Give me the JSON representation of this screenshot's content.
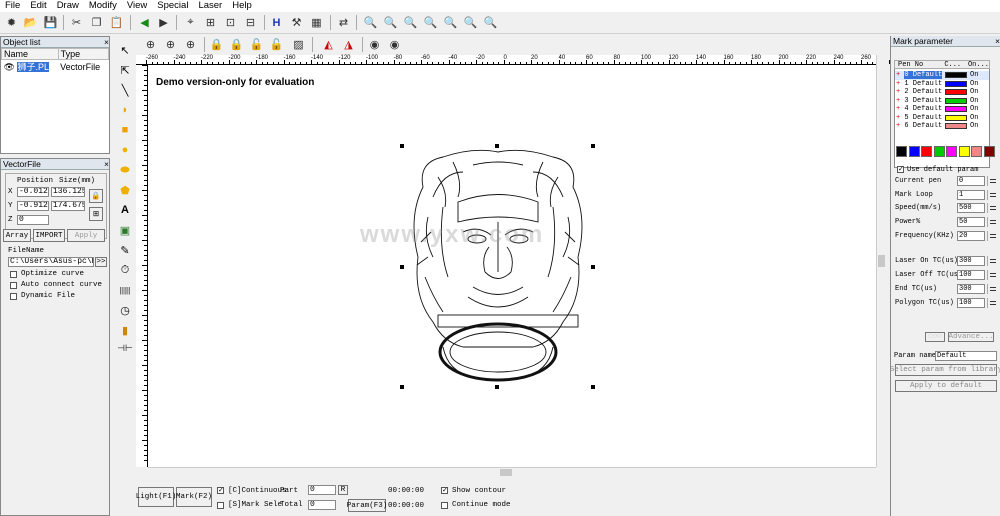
{
  "menu": [
    "File",
    "Edit",
    "Draw",
    "Modify",
    "View",
    "Special",
    "Laser",
    "Help"
  ],
  "object_list": {
    "title": "Object list",
    "columns": [
      "Name",
      "Type"
    ],
    "rows": [
      {
        "name": "狮子.PL",
        "type": "VectorFile"
      }
    ]
  },
  "vector_file": {
    "title": "VectorFile",
    "position_label": "Position",
    "size_label": "Size(mm)",
    "x_label": "X",
    "y_label": "Y",
    "z_label": "Z",
    "x_pos": "-0.012",
    "x_size": "136.125",
    "y_pos": "-0.912",
    "y_size": "174.675",
    "z_pos": "0",
    "array_label": "Array",
    "import_label": "IMPORT",
    "apply_label": "Apply",
    "filename_label": "FileName",
    "filename_value": "C:\\Users\\Asus-pc\\Desk",
    "browse_label": ">>",
    "optimize_label": "Optimize curve",
    "autoconnect_label": "Auto connect curve",
    "dynamic_label": "Dynamic File"
  },
  "canvas": {
    "watermark_text": "Demo version-only for evaluation",
    "overlay_text": "www.yxw.com",
    "ruler_labels": [
      "-260",
      "-240",
      "-220",
      "-200",
      "-180",
      "-160",
      "-140",
      "-120",
      "-100",
      "-80",
      "-60",
      "-40",
      "-20",
      "0",
      "20",
      "40",
      "60",
      "80",
      "100",
      "120",
      "140",
      "160",
      "180",
      "200",
      "220",
      "240",
      "260"
    ]
  },
  "bottom_bar": {
    "light_label": "Light(F1)",
    "mark_label": "Mark(F2)",
    "continuous_label": "[C]Continuous",
    "continuous_checked": true,
    "mark_sele_label": "[S]Mark Sele",
    "part_label": "Part",
    "part_value": "0",
    "r_label": "R",
    "total_label": "Total",
    "total_value": "0",
    "time1": "00:00:00",
    "time2": "00:00:00",
    "param_label": "Param(F3)",
    "show_contour_label": "Show contour",
    "show_contour_checked": true,
    "continue_mode_label": "Continue mode"
  },
  "mark_parameter": {
    "title": "Mark parameter",
    "pen_cols": [
      "Pen No",
      "C...",
      "On..."
    ],
    "pens": [
      {
        "name": "0 Default",
        "color": "#000000",
        "on": "On",
        "selected": true
      },
      {
        "name": "1 Default",
        "color": "#0000ff",
        "on": "On"
      },
      {
        "name": "2 Default",
        "color": "#ff0000",
        "on": "On"
      },
      {
        "name": "3 Default",
        "color": "#00cc00",
        "on": "On"
      },
      {
        "name": "4 Default",
        "color": "#ff00ff",
        "on": "On"
      },
      {
        "name": "5 Default",
        "color": "#ffff00",
        "on": "On"
      },
      {
        "name": "6 Default",
        "color": "#ee8888",
        "on": "On"
      }
    ],
    "swatches": [
      "#000000",
      "#0000ff",
      "#ff0000",
      "#00cc00",
      "#ff00ff",
      "#ffff00",
      "#ee8888",
      "#800000"
    ],
    "use_default_label": "Use default param",
    "params": [
      {
        "label": "Current pen",
        "value": "0"
      },
      {
        "label": "Mark Loop",
        "value": "1"
      },
      {
        "label": "Speed(mm/s)",
        "value": "500"
      },
      {
        "label": "Power%",
        "value": "50"
      },
      {
        "label": "Frequency(KHz)",
        "value": "20"
      },
      {
        "label": "Laser On TC(us)",
        "value": "300"
      },
      {
        "label": "Laser Off TC(us)",
        "value": "100"
      },
      {
        "label": "End TC(us)",
        "value": "300"
      },
      {
        "label": "Polygon TC(us)",
        "value": "100"
      }
    ],
    "advance_label": "Advance...",
    "param_name_label": "Param name",
    "param_name_value": "Default",
    "select_lib_label": "Select param from library",
    "apply_default_label": "Apply to default"
  }
}
